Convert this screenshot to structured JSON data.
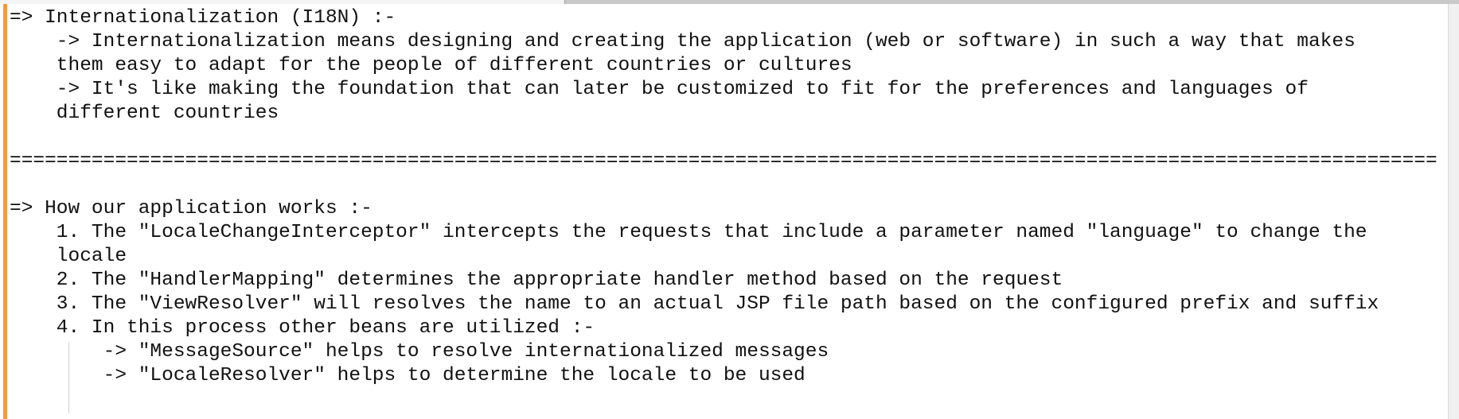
{
  "editor": {
    "lines": [
      "=> Internationalization (I18N) :-",
      "    -> Internationalization means designing and creating the application (web or software) in such a way that makes",
      "    them easy to adapt for the people of different countries or cultures",
      "    -> It's like making the foundation that can later be customized to fit for the preferences and languages of",
      "    different countries",
      "",
      "==========================================================================================================================",
      "",
      "=> How our application works :-",
      "    1. The \"LocaleChangeInterceptor\" intercepts the requests that include a parameter named \"language\" to change the",
      "    locale",
      "    2. The \"HandlerMapping\" determines the appropriate handler method based on the request",
      "    3. The \"ViewResolver\" will resolves the name to an actual JSP file path based on the configured prefix and suffix",
      "    4. In this process other beans are utilized :-",
      "        -> \"MessageSource\" helps to resolve internationalized messages",
      "        -> \"LocaleResolver\" helps to determine the locale to be used",
      ""
    ]
  }
}
